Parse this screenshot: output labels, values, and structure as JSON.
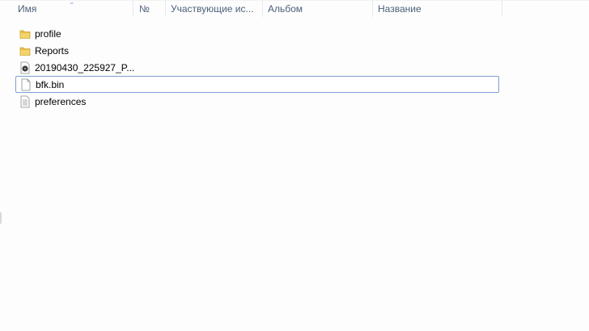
{
  "columns": {
    "name": "Имя",
    "number": "№",
    "artists": "Участвующие ис...",
    "album": "Альбом",
    "title": "Название"
  },
  "files": [
    {
      "name": "profile",
      "icon": "folder-icon"
    },
    {
      "name": "Reports",
      "icon": "folder-icon"
    },
    {
      "name": "20190430_225927_P...",
      "icon": "media-file-icon"
    },
    {
      "name": "bfk.bin",
      "icon": "blank-file-icon",
      "selected": true
    },
    {
      "name": "preferences",
      "icon": "text-file-icon"
    }
  ],
  "colors": {
    "header_text": "#4c607a",
    "selection_border": "#7da2ce",
    "folder_yellow": "#e8c04a"
  }
}
